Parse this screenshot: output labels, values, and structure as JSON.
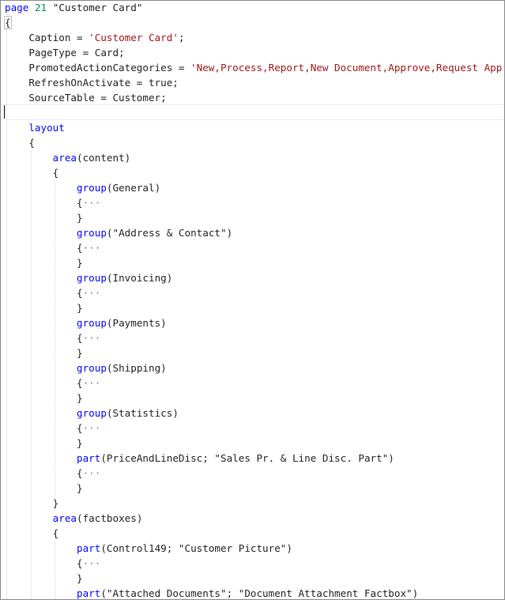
{
  "colors": {
    "keyword": "#0000ff",
    "number": "#098658",
    "string": "#a31515",
    "text": "#1e1e1e",
    "fold_marker": "#7a7a7a"
  },
  "lines": [
    [
      {
        "t": "page",
        "k": "kw"
      },
      {
        "t": " ",
        "k": "plain"
      },
      {
        "t": "21",
        "k": "num"
      },
      {
        "t": " \"Customer Card\"",
        "k": "plain"
      }
    ],
    [
      {
        "t": "{",
        "k": "plain",
        "box": true
      }
    ],
    [
      {
        "t": "    Caption = ",
        "k": "plain"
      },
      {
        "t": "'Customer Card'",
        "k": "str"
      },
      {
        "t": ";",
        "k": "plain"
      }
    ],
    [
      {
        "t": "    PageType = Card;",
        "k": "plain"
      }
    ],
    [
      {
        "t": "    PromotedActionCategories = ",
        "k": "plain"
      },
      {
        "t": "'New,Process,Report,New Document,Approve,Request App",
        "k": "str"
      }
    ],
    [
      {
        "t": "    RefreshOnActivate = true;",
        "k": "plain"
      }
    ],
    [
      {
        "t": "    SourceTable = Customer;",
        "k": "plain"
      }
    ],
    [],
    [
      {
        "t": "    ",
        "k": "plain"
      },
      {
        "t": "layout",
        "k": "kw"
      }
    ],
    [
      {
        "t": "    {",
        "k": "plain"
      }
    ],
    [
      {
        "t": "        ",
        "k": "plain"
      },
      {
        "t": "area",
        "k": "kw"
      },
      {
        "t": "(content)",
        "k": "plain"
      }
    ],
    [
      {
        "t": "        {",
        "k": "plain"
      }
    ],
    [
      {
        "t": "            ",
        "k": "plain"
      },
      {
        "t": "group",
        "k": "kw"
      },
      {
        "t": "(General)",
        "k": "plain"
      }
    ],
    [
      {
        "t": "            {",
        "k": "plain"
      },
      {
        "t": "···",
        "k": "fold"
      }
    ],
    [
      {
        "t": "            }",
        "k": "plain"
      }
    ],
    [
      {
        "t": "            ",
        "k": "plain"
      },
      {
        "t": "group",
        "k": "kw"
      },
      {
        "t": "(\"Address & Contact\")",
        "k": "plain"
      }
    ],
    [
      {
        "t": "            {",
        "k": "plain"
      },
      {
        "t": "···",
        "k": "fold"
      }
    ],
    [
      {
        "t": "            }",
        "k": "plain"
      }
    ],
    [
      {
        "t": "            ",
        "k": "plain"
      },
      {
        "t": "group",
        "k": "kw"
      },
      {
        "t": "(Invoicing)",
        "k": "plain"
      }
    ],
    [
      {
        "t": "            {",
        "k": "plain"
      },
      {
        "t": "···",
        "k": "fold"
      }
    ],
    [
      {
        "t": "            }",
        "k": "plain"
      }
    ],
    [
      {
        "t": "            ",
        "k": "plain"
      },
      {
        "t": "group",
        "k": "kw"
      },
      {
        "t": "(Payments)",
        "k": "plain"
      }
    ],
    [
      {
        "t": "            {",
        "k": "plain"
      },
      {
        "t": "···",
        "k": "fold"
      }
    ],
    [
      {
        "t": "            }",
        "k": "plain"
      }
    ],
    [
      {
        "t": "            ",
        "k": "plain"
      },
      {
        "t": "group",
        "k": "kw"
      },
      {
        "t": "(Shipping)",
        "k": "plain"
      }
    ],
    [
      {
        "t": "            {",
        "k": "plain"
      },
      {
        "t": "···",
        "k": "fold"
      }
    ],
    [
      {
        "t": "            }",
        "k": "plain"
      }
    ],
    [
      {
        "t": "            ",
        "k": "plain"
      },
      {
        "t": "group",
        "k": "kw"
      },
      {
        "t": "(Statistics)",
        "k": "plain"
      }
    ],
    [
      {
        "t": "            {",
        "k": "plain"
      },
      {
        "t": "···",
        "k": "fold"
      }
    ],
    [
      {
        "t": "            }",
        "k": "plain"
      }
    ],
    [
      {
        "t": "            ",
        "k": "plain"
      },
      {
        "t": "part",
        "k": "kw"
      },
      {
        "t": "(PriceAndLineDisc; \"Sales Pr. & Line Disc. Part\")",
        "k": "plain"
      }
    ],
    [
      {
        "t": "            {",
        "k": "plain"
      },
      {
        "t": "···",
        "k": "fold"
      }
    ],
    [
      {
        "t": "            }",
        "k": "plain"
      }
    ],
    [
      {
        "t": "        }",
        "k": "plain"
      }
    ],
    [
      {
        "t": "        ",
        "k": "plain"
      },
      {
        "t": "area",
        "k": "kw"
      },
      {
        "t": "(factboxes)",
        "k": "plain"
      }
    ],
    [
      {
        "t": "        {",
        "k": "plain"
      }
    ],
    [
      {
        "t": "            ",
        "k": "plain"
      },
      {
        "t": "part",
        "k": "kw"
      },
      {
        "t": "(Control149; \"Customer Picture\")",
        "k": "plain"
      }
    ],
    [
      {
        "t": "            {",
        "k": "plain"
      },
      {
        "t": "···",
        "k": "fold"
      }
    ],
    [
      {
        "t": "            }",
        "k": "plain"
      }
    ],
    [
      {
        "t": "            ",
        "k": "plain"
      },
      {
        "t": "part",
        "k": "kw"
      },
      {
        "t": "(\"Attached Documents\"; \"Document Attachment Factbox\")",
        "k": "plain"
      }
    ]
  ]
}
